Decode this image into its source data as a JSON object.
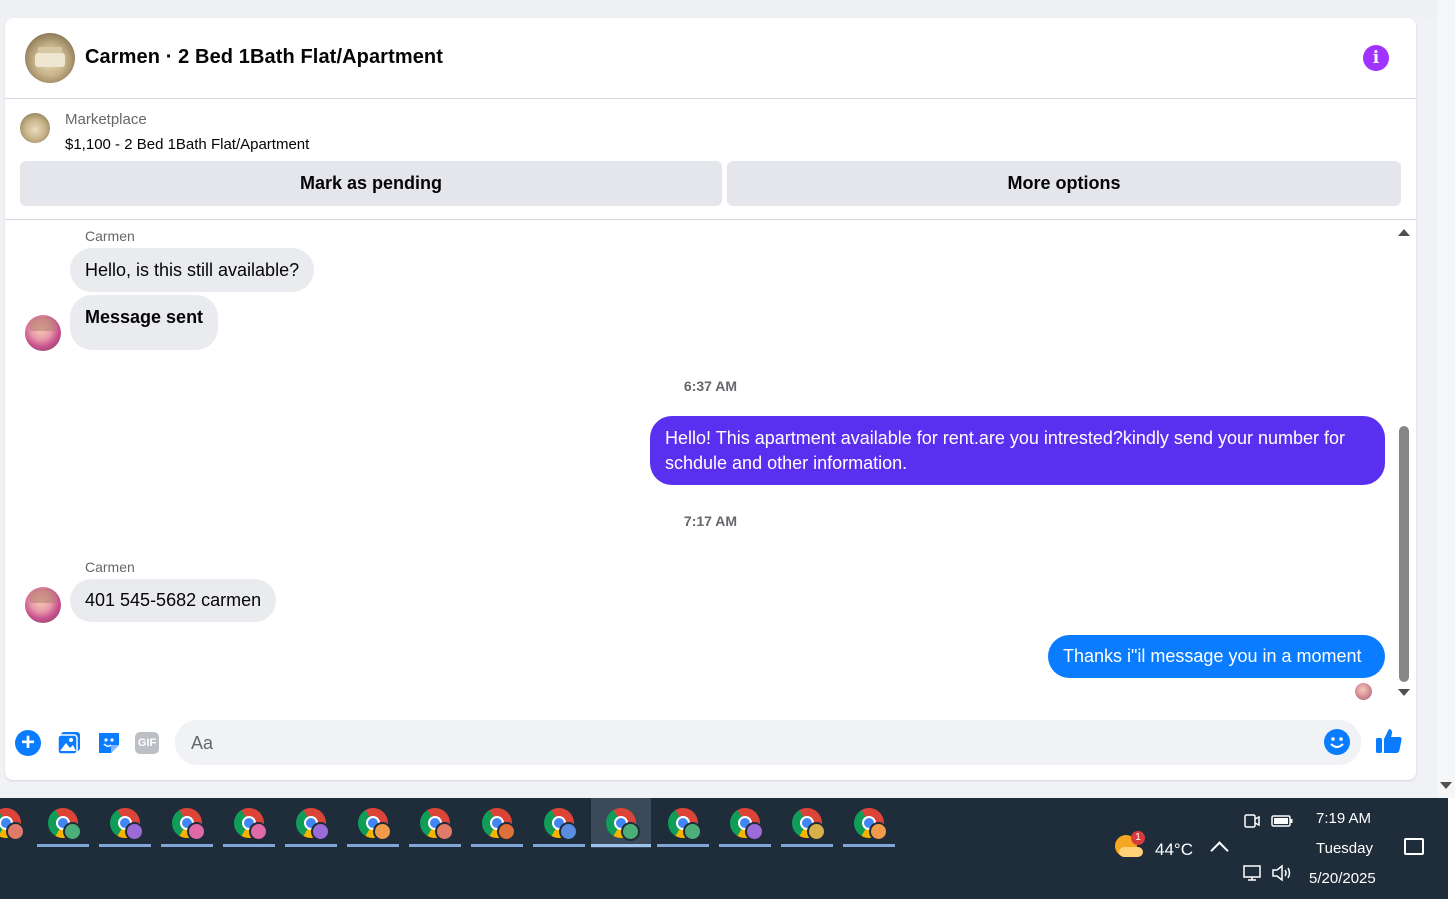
{
  "header": {
    "title": "Carmen · 2 Bed 1Bath Flat/Apartment",
    "info_icon": "info-icon",
    "accent_color": "#a033ff"
  },
  "marketplace": {
    "label": "Marketplace",
    "listing": "$1,100 - 2 Bed 1Bath Flat/Apartment",
    "buttons": {
      "mark_pending": "Mark as pending",
      "more_options": "More options"
    }
  },
  "messages": [
    {
      "sender": "Carmen"
    },
    {
      "text": "Hello, is this still available?"
    },
    {
      "text": "Message sent"
    },
    {
      "timestamp": "6:37 AM"
    },
    {
      "text": "Hello! This apartment available for rent.are you intrested?kindly send your number for schdule and other information."
    },
    {
      "timestamp": "7:17 AM"
    },
    {
      "sender": "Carmen"
    },
    {
      "text": "401 545-5682 carmen"
    },
    {
      "text": "Thanks i\"il message you in a moment"
    }
  ],
  "colors": {
    "outgoing_purple": "#5b2ff0",
    "outgoing_blue": "#0a7cff",
    "incoming_bg": "#e9ebee"
  },
  "composer": {
    "placeholder": "Aa",
    "icons": [
      "plus-icon",
      "photo-icon",
      "sticker-icon",
      "gif-icon",
      "emoji-icon",
      "thumbs-up-icon"
    ],
    "gif_label": "GIF"
  },
  "taskbar": {
    "weather": {
      "temperature": "44°C",
      "badge": "1"
    },
    "clock": {
      "time": "7:19 AM",
      "day": "Tuesday",
      "date": "5/20/2025"
    }
  }
}
